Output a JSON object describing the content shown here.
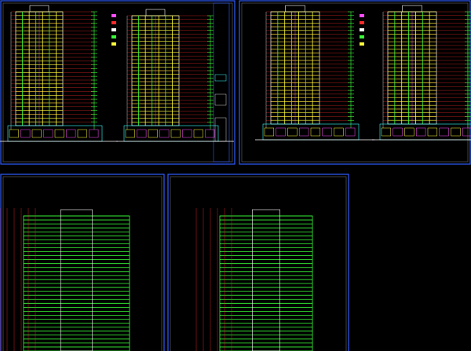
{
  "app": {
    "title": ""
  },
  "drawing": {
    "colors": {
      "background": "#000000",
      "frame": "#2f5cff",
      "frame_inner": "#7f7f7f",
      "dim_red": "#ff2a2a",
      "tower_yellow": "#ffff3a",
      "tower_green": "#39ff39",
      "tower_white": "#ffffff",
      "tower_cyan": "#39ffff",
      "tower_magenta": "#ff4dff"
    },
    "sheets": [
      {
        "id": "sheet-1",
        "title_text": ""
      },
      {
        "id": "sheet-2",
        "title_text": ""
      },
      {
        "id": "sheet-3",
        "title_text": ""
      },
      {
        "id": "sheet-4",
        "title_text": ""
      }
    ]
  }
}
